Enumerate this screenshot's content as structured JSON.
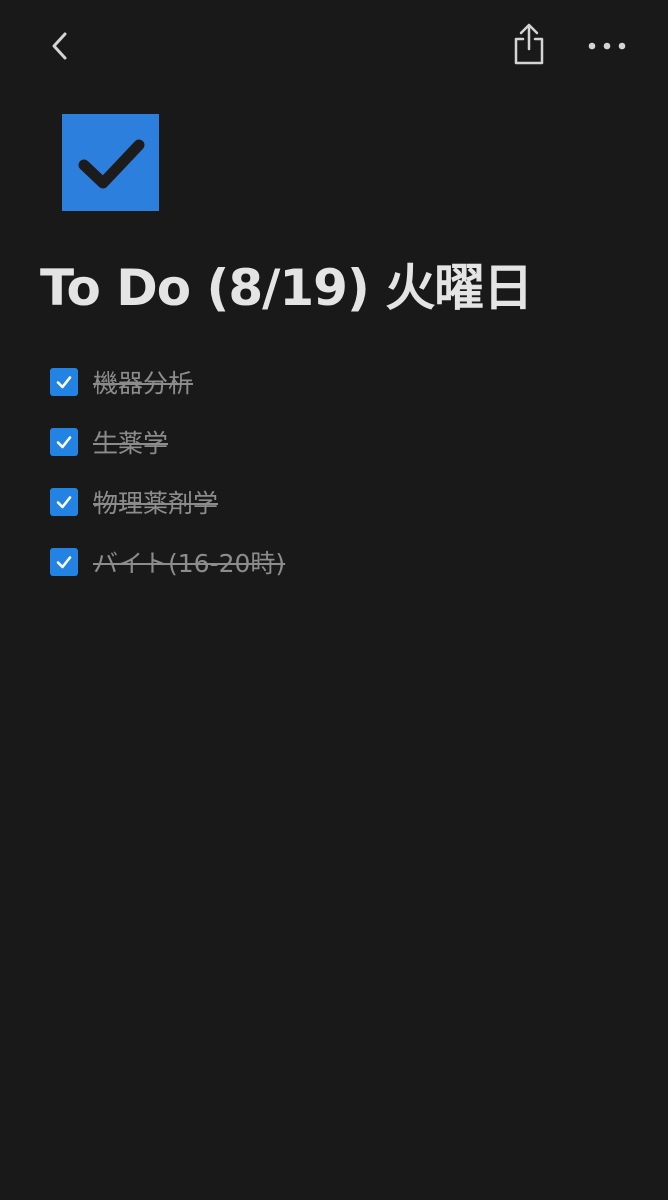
{
  "header": {
    "back_icon": "chevron-left-icon",
    "share_icon": "share-icon",
    "more_icon": "more-horizontal-icon"
  },
  "page": {
    "icon": "checkbox-icon",
    "icon_color": "#2383e2",
    "title": "To Do (8/19)  火曜日"
  },
  "todos": [
    {
      "text": "機器分析",
      "checked": true
    },
    {
      "text": "生薬学",
      "checked": true
    },
    {
      "text": "物理薬剤学",
      "checked": true
    },
    {
      "text": "バイト(16-20時)",
      "checked": true
    }
  ],
  "colors": {
    "background": "#191919",
    "accent": "#2383e2",
    "title_text": "#e4e4e4",
    "done_text": "#8c8c8c"
  }
}
